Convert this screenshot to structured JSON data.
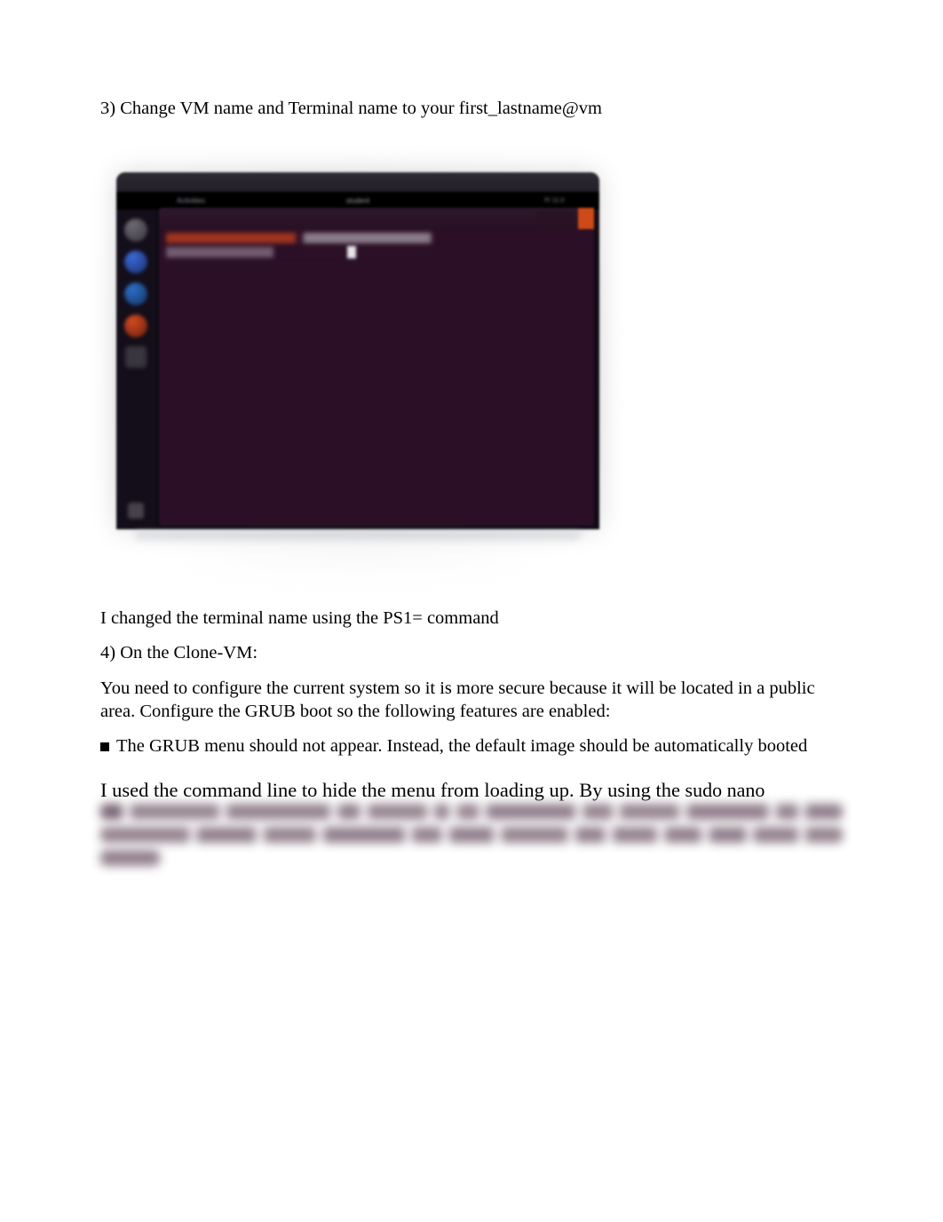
{
  "q3_heading": "3) Change VM name and Terminal name to your first_lastname@vm",
  "screenshot": {
    "menu_center": "student",
    "menu_right": "Fr 11:3",
    "menu_left": "Activities"
  },
  "answer3": "I changed the terminal name using the PS1= command",
  "q4_heading": "4) On the Clone-VM:",
  "q4_body": "You need to configure the current system so it is more secure because it will be located in a public area. Configure the GRUB boot so the following features are enabled:",
  "q4_bullet": "The GRUB menu should not appear. Instead, the default image should be automatically booted",
  "answer4_visible_prefix": "I used the command line to hide the menu from loading up. By using the",
  "answer4_visible_cmd": " sudo nano"
}
